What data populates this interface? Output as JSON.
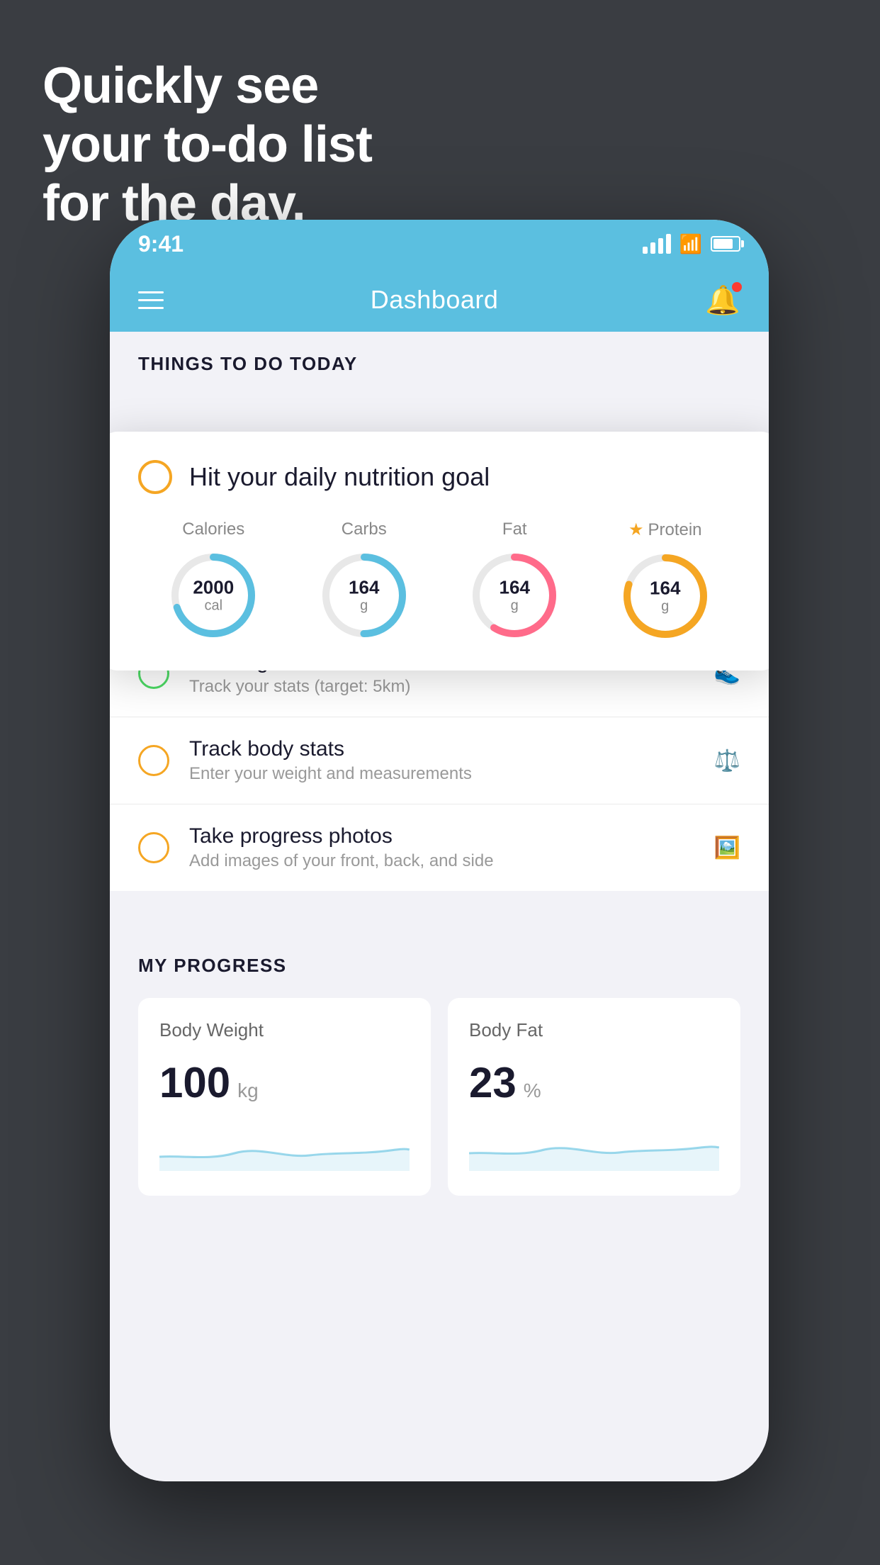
{
  "hero": {
    "line1": "Quickly see",
    "line2": "your to-do list",
    "line3": "for the day."
  },
  "phone": {
    "status_bar": {
      "time": "9:41"
    },
    "navbar": {
      "title": "Dashboard"
    },
    "things_section": {
      "title": "THINGS TO DO TODAY"
    },
    "floating_card": {
      "title": "Hit your daily nutrition goal",
      "nutrients": [
        {
          "label": "Calories",
          "value": "2000",
          "unit": "cal",
          "color": "#5bbfe0",
          "progress": 0.7,
          "starred": false
        },
        {
          "label": "Carbs",
          "value": "164",
          "unit": "g",
          "color": "#5bbfe0",
          "progress": 0.5,
          "starred": false
        },
        {
          "label": "Fat",
          "value": "164",
          "unit": "g",
          "color": "#ff6b8a",
          "progress": 0.6,
          "starred": false
        },
        {
          "label": "Protein",
          "value": "164",
          "unit": "g",
          "color": "#f5a623",
          "progress": 0.8,
          "starred": true
        }
      ]
    },
    "todo_items": [
      {
        "id": "running",
        "title": "Running",
        "subtitle": "Track your stats (target: 5km)",
        "circle_color": "green",
        "icon": "👟"
      },
      {
        "id": "body-stats",
        "title": "Track body stats",
        "subtitle": "Enter your weight and measurements",
        "circle_color": "yellow",
        "icon": "⚖️"
      },
      {
        "id": "progress-photos",
        "title": "Take progress photos",
        "subtitle": "Add images of your front, back, and side",
        "circle_color": "yellow",
        "icon": "🖼️"
      }
    ],
    "progress_section": {
      "title": "MY PROGRESS",
      "cards": [
        {
          "title": "Body Weight",
          "value": "100",
          "unit": "kg"
        },
        {
          "title": "Body Fat",
          "value": "23",
          "unit": "%"
        }
      ]
    }
  }
}
